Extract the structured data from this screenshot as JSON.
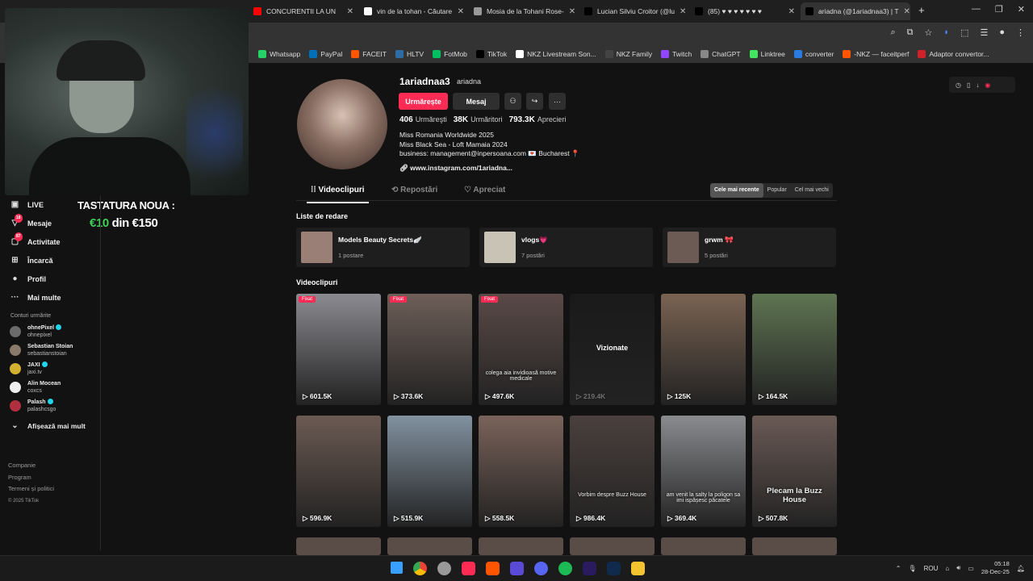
{
  "browser": {
    "tabs": [
      {
        "label": "CONCURENTII LA UN",
        "color": "#ff0000"
      },
      {
        "label": "vin de la tohan - Căutare",
        "color": "#ffffff"
      },
      {
        "label": "Mosia de la Tohani Rose-",
        "color": "#999999"
      },
      {
        "label": "Lucian Silviu Croitor (@lu",
        "color": "#000000"
      },
      {
        "label": "(85) ♥ ♥ ♥ ♥ ♥ ♥ ♥",
        "color": "#000000"
      },
      {
        "label": "ariadna (@1ariadnaa3) | T",
        "color": "#000000"
      }
    ],
    "bookmarks": [
      {
        "label": "Whatsapp",
        "color": "#25d366"
      },
      {
        "label": "PayPal",
        "color": "#0070ba"
      },
      {
        "label": "FACEIT",
        "color": "#ff5500"
      },
      {
        "label": "HLTV",
        "color": "#2d6da3"
      },
      {
        "label": "FotMob",
        "color": "#00c060"
      },
      {
        "label": "TikTok",
        "color": "#000000"
      },
      {
        "label": "NKZ Livestream Son...",
        "color": "#ffffff"
      },
      {
        "label": "NKZ Family",
        "color": "#444444"
      },
      {
        "label": "Twitch",
        "color": "#9146ff"
      },
      {
        "label": "ChatGPT",
        "color": "#888888"
      },
      {
        "label": "Linktree",
        "color": "#43e660"
      },
      {
        "label": "converter",
        "color": "#2a7ae2"
      },
      {
        "label": "-NKZ — faceitperf",
        "color": "#ff5500"
      },
      {
        "label": "Adaptor convertor...",
        "color": "#d0202a"
      }
    ]
  },
  "overlay": {
    "line1": "TASTATURA NOUA :",
    "price_a": "€10",
    "price_b": " din €150"
  },
  "sidebar": {
    "nav": [
      {
        "label": "LIVE",
        "icon": "▣"
      },
      {
        "label": "Mesaje",
        "icon": "▽",
        "badge": "18"
      },
      {
        "label": "Activitate",
        "icon": "▢",
        "badge": "87"
      },
      {
        "label": "Încarcă",
        "icon": "⊞"
      },
      {
        "label": "Profil",
        "icon": "●"
      },
      {
        "label": "Mai multe",
        "icon": "···"
      }
    ],
    "following_title": "Conturi urmărite",
    "following": [
      {
        "name": "ohnePixel",
        "handle": "ohnepixel",
        "verified": true
      },
      {
        "name": "Sebastian Stoian",
        "handle": "sebastianstoian",
        "verified": false
      },
      {
        "name": "JAXI",
        "handle": "jaxi.tv",
        "verified": true
      },
      {
        "name": "Alin Mocean",
        "handle": "coxcs",
        "verified": false
      },
      {
        "name": "Palash",
        "handle": "palashcsgo",
        "verified": true
      }
    ],
    "show_more": "Afișează mai mult",
    "footer": [
      "Companie",
      "Program",
      "Termeni și politici"
    ],
    "copyright": "© 2025 TikTok"
  },
  "profile": {
    "username": "1ariadnaa3",
    "nickname": "ariadna",
    "follow_label": "Urmărește",
    "message_label": "Mesaj",
    "stats": [
      {
        "value": "406",
        "label": "Urmăreşti"
      },
      {
        "value": "38K",
        "label": "Urmăritori"
      },
      {
        "value": "793.3K",
        "label": "Aprecieri"
      }
    ],
    "bio": [
      "Miss Romania Worldwide 2025",
      "Miss Black Sea - Loft Mamaia 2024",
      "business: management@inpersoana.com 💌 Bucharest 📍"
    ],
    "link": "www.instagram.com/1ariadna..."
  },
  "profile_tabs": [
    "Videoclipuri",
    "Repostări",
    "Apreciat"
  ],
  "sort_options": [
    "Cele mai recente",
    "Popular",
    "Cel mai vechi"
  ],
  "playlists_title": "Liste de redare",
  "playlists": [
    {
      "title": "Models Beauty Secrets🪽",
      "count": "1 postare",
      "color": "#9a7f76"
    },
    {
      "title": "vlogs💗",
      "count": "7 postări",
      "color": "#c9c3b5"
    },
    {
      "title": "grwm 🎀",
      "count": "5 postări",
      "color": "#6c5a55"
    }
  ],
  "videos_title": "Videoclipuri",
  "videos": [
    {
      "views": "601.5K",
      "pinned": true,
      "color": "#8b8a90",
      "caption": ""
    },
    {
      "views": "373.6K",
      "pinned": true,
      "color": "#6e5f58",
      "caption": ""
    },
    {
      "views": "497.6K",
      "pinned": true,
      "color": "#5a4a48",
      "caption": "colega aia invidioasă motive medicale"
    },
    {
      "views": "219.4K",
      "pinned": false,
      "color": "#1a1a1a",
      "caption": "",
      "watched": "Vizionate"
    },
    {
      "views": "125K",
      "pinned": false,
      "color": "#7a6352",
      "caption": ""
    },
    {
      "views": "164.5K",
      "pinned": false,
      "color": "#5f7552",
      "caption": ""
    },
    {
      "views": "596.9K",
      "pinned": false,
      "color": "#6b5a52",
      "caption": ""
    },
    {
      "views": "515.9K",
      "pinned": false,
      "color": "#8292a0",
      "caption": ""
    },
    {
      "views": "558.5K",
      "pinned": false,
      "color": "#7a635a",
      "caption": ""
    },
    {
      "views": "986.4K",
      "pinned": false,
      "color": "#4a403d",
      "caption": "Vorbim despre Buzz House"
    },
    {
      "views": "369.4K",
      "pinned": false,
      "color": "#8a8b8f",
      "caption": "am venit la salty la poligon sa imi ispășesc păcatele"
    },
    {
      "views": "507.8K",
      "pinned": false,
      "color": "#6a5a55",
      "caption": "Plecam la Buzz House"
    }
  ],
  "system": {
    "lang": "ROU",
    "time": "05:18",
    "date": "28-Dec-25"
  }
}
